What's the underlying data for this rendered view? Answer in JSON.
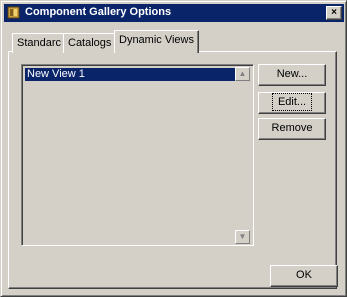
{
  "window": {
    "title": "Component Gallery Options",
    "close_label": "×"
  },
  "tabs": [
    {
      "label": "Standarc"
    },
    {
      "label": "Catalogs"
    },
    {
      "label": "Dynamic Views"
    }
  ],
  "list": {
    "items": [
      "New View 1"
    ],
    "scroll_up": "▲",
    "scroll_down": "▼"
  },
  "buttons": {
    "new": "New...",
    "edit": "Edit...",
    "remove": "Remove",
    "ok": "OK"
  },
  "colors": {
    "titlebar": "#0a246a",
    "selection": "#0a246a",
    "face": "#d4d0c8"
  },
  "icons": {
    "app": "component-gallery-icon"
  }
}
